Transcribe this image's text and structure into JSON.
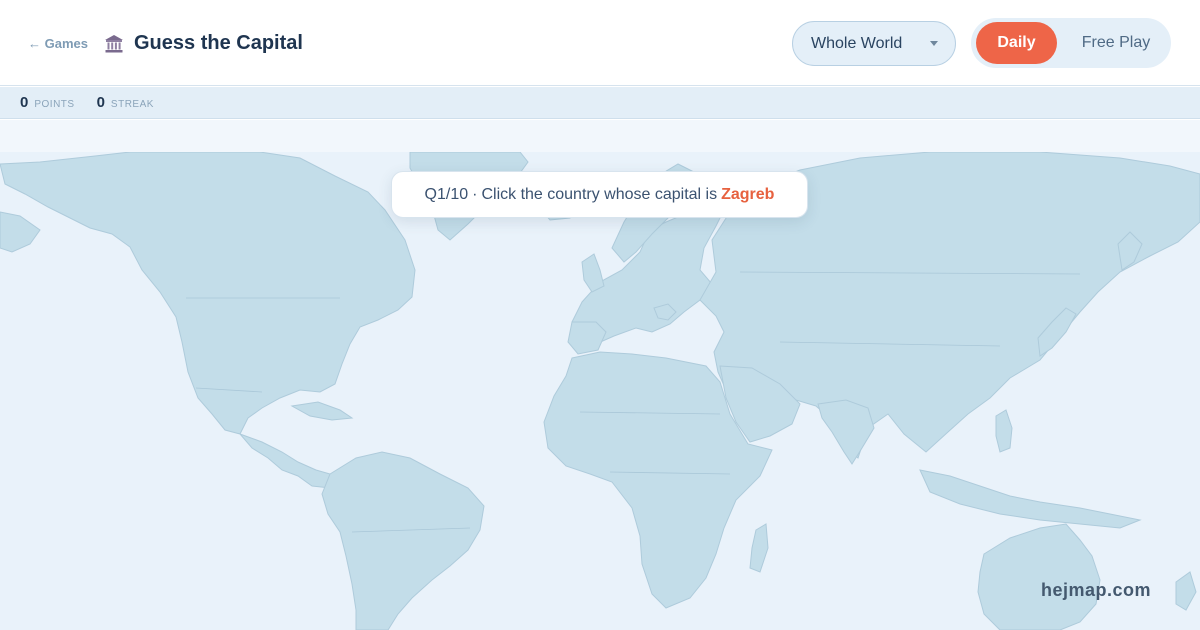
{
  "header": {
    "back_label": "← Games",
    "title": "Guess the Capital",
    "title_icon": "classical-building-icon"
  },
  "region_select": {
    "selected": "Whole World"
  },
  "mode_toggle": {
    "daily_label": "Daily",
    "free_play_label": "Free Play",
    "active": "Daily"
  },
  "stats": {
    "points_value": "0",
    "points_label": "POINTS",
    "streak_value": "0",
    "streak_label": "STREAK"
  },
  "prompt": {
    "progress": "Q1/10",
    "separator": "·",
    "question": "Click the country whose capital is",
    "capital": "Zagreb"
  },
  "watermark": "hejmap.com",
  "colors": {
    "accent": "#ee6548",
    "land": "#c3dde9",
    "ocean": "#e9f2fa",
    "title": "#1f3550"
  }
}
